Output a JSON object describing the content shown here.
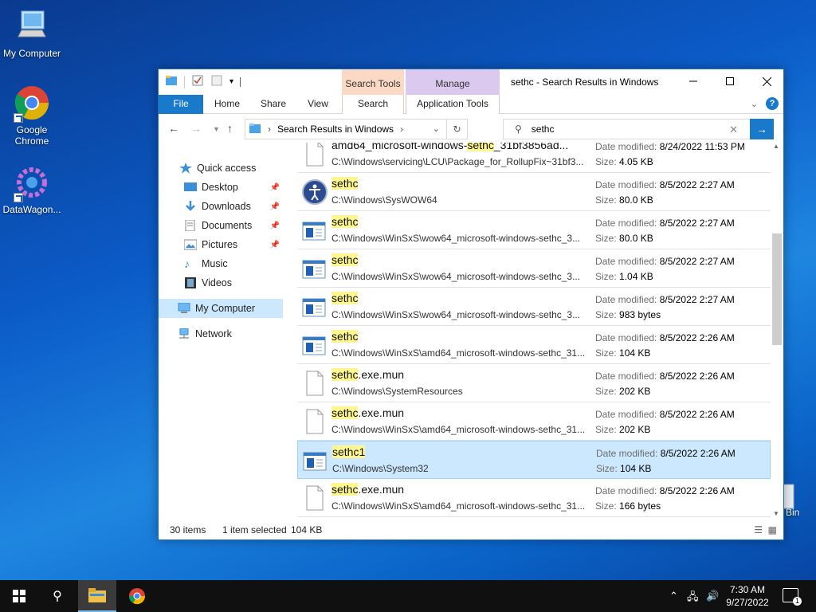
{
  "desktop": {
    "icons": [
      {
        "label": "My Computer"
      },
      {
        "label": "Google Chrome"
      },
      {
        "label": "DataWagon..."
      }
    ],
    "recycle_bin_label": "Bin"
  },
  "window": {
    "title": "sethc - Search Results in Windows",
    "contextual_tabs": {
      "search_group": "Search Tools",
      "manage_group": "Manage"
    },
    "ribbon_tabs": [
      "File",
      "Home",
      "Share",
      "View",
      "Search",
      "Application Tools"
    ],
    "address": {
      "location": "Search Results in Windows"
    },
    "search": {
      "query": "sethc"
    },
    "nav_pane": {
      "quick_access": "Quick access",
      "items": [
        "Desktop",
        "Downloads",
        "Documents",
        "Pictures",
        "Music",
        "Videos"
      ],
      "my_computer": "My Computer",
      "network": "Network"
    },
    "results": [
      {
        "name_pre": "amd64_microsoft-windows-",
        "name_hl": "sethc",
        "name_post": "_31bf3856ad...",
        "path": "C:\\Windows\\servicing\\LCU\\Package_for_RollupFix~31bf3...",
        "date_label": "Date modified:",
        "date": "8/24/2022 11:53 PM",
        "size_label": "Size:",
        "size": "4.05 KB",
        "icon": "blank-file-icon"
      },
      {
        "name_pre": "",
        "name_hl": "sethc",
        "name_post": "",
        "path": "C:\\Windows\\SysWOW64",
        "date_label": "Date modified:",
        "date": "8/5/2022 2:27 AM",
        "size_label": "Size:",
        "size": "80.0 KB",
        "icon": "accessibility-app-icon"
      },
      {
        "name_pre": "",
        "name_hl": "sethc",
        "name_post": "",
        "path": "C:\\Windows\\WinSxS\\wow64_microsoft-windows-sethc_3...",
        "date_label": "Date modified:",
        "date": "8/5/2022 2:27 AM",
        "size_label": "Size:",
        "size": "80.0 KB",
        "icon": "app-window-icon"
      },
      {
        "name_pre": "",
        "name_hl": "sethc",
        "name_post": "",
        "path": "C:\\Windows\\WinSxS\\wow64_microsoft-windows-sethc_3...",
        "date_label": "Date modified:",
        "date": "8/5/2022 2:27 AM",
        "size_label": "Size:",
        "size": "1.04 KB",
        "icon": "app-window-icon"
      },
      {
        "name_pre": "",
        "name_hl": "sethc",
        "name_post": "",
        "path": "C:\\Windows\\WinSxS\\wow64_microsoft-windows-sethc_3...",
        "date_label": "Date modified:",
        "date": "8/5/2022 2:27 AM",
        "size_label": "Size:",
        "size": "983 bytes",
        "icon": "app-window-icon"
      },
      {
        "name_pre": "",
        "name_hl": "sethc",
        "name_post": "",
        "path": "C:\\Windows\\WinSxS\\amd64_microsoft-windows-sethc_31...",
        "date_label": "Date modified:",
        "date": "8/5/2022 2:26 AM",
        "size_label": "Size:",
        "size": "104 KB",
        "icon": "app-window-icon"
      },
      {
        "name_pre": "",
        "name_hl": "sethc",
        "name_post": ".exe.mun",
        "path": "C:\\Windows\\SystemResources",
        "date_label": "Date modified:",
        "date": "8/5/2022 2:26 AM",
        "size_label": "Size:",
        "size": "202 KB",
        "icon": "blank-file-icon"
      },
      {
        "name_pre": "",
        "name_hl": "sethc",
        "name_post": ".exe.mun",
        "path": "C:\\Windows\\WinSxS\\amd64_microsoft-windows-sethc_31...",
        "date_label": "Date modified:",
        "date": "8/5/2022 2:26 AM",
        "size_label": "Size:",
        "size": "202 KB",
        "icon": "blank-file-icon"
      },
      {
        "name_pre": "",
        "name_hl": "sethc1",
        "name_post": "",
        "path": "C:\\Windows\\System32",
        "date_label": "Date modified:",
        "date": "8/5/2022 2:26 AM",
        "size_label": "Size:",
        "size": "104 KB",
        "icon": "app-window-icon",
        "selected": true
      },
      {
        "name_pre": "",
        "name_hl": "sethc",
        "name_post": ".exe.mun",
        "path": "C:\\Windows\\WinSxS\\amd64_microsoft-windows-sethc_31...",
        "date_label": "Date modified:",
        "date": "8/5/2022 2:26 AM",
        "size_label": "Size:",
        "size": "166 bytes",
        "icon": "blank-file-icon"
      }
    ],
    "status": {
      "count": "30 items",
      "selection": "1 item selected",
      "size": "104 KB"
    }
  },
  "taskbar": {
    "time": "7:30 AM",
    "date": "9/27/2022",
    "notification_count": "1"
  },
  "colors": {
    "accent": "#1979ca",
    "highlight": "#fff68f",
    "selection": "#cce8ff"
  }
}
